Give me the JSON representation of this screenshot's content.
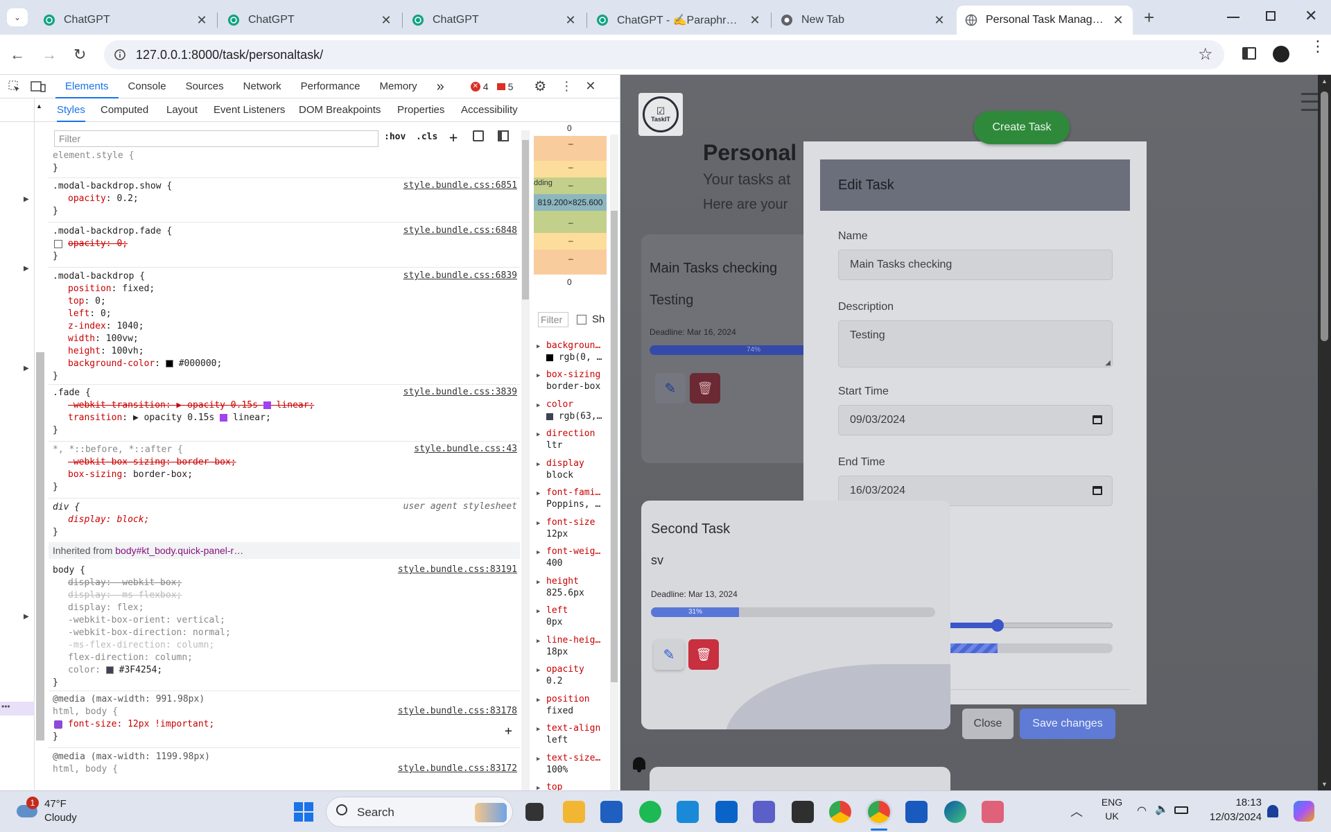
{
  "browser": {
    "tabs": [
      {
        "title": "ChatGPT"
      },
      {
        "title": "ChatGPT"
      },
      {
        "title": "ChatGPT"
      },
      {
        "title": "ChatGPT - ✍️Paraphrase &"
      },
      {
        "title": "New Tab"
      },
      {
        "title": "Personal Task Managemen"
      }
    ],
    "url": "127.0.0.1:8000/task/personaltask/"
  },
  "devtools": {
    "tabs": [
      "Elements",
      "Console",
      "Sources",
      "Network",
      "Performance",
      "Memory"
    ],
    "more": "»",
    "errors": "4",
    "warnings": "5",
    "subtabs": [
      "Styles",
      "Computed",
      "Layout",
      "Event Listeners",
      "DOM Breakpoints",
      "Properties",
      "Accessibility"
    ],
    "filter_placeholder": "Filter",
    "hov": ":hov",
    "cls": ".cls",
    "rules": {
      "element_style": "element.style {",
      "close": "}",
      "r1_sel": ".modal-backdrop.show {",
      "r1_src": "style.bundle.css:6851",
      "r1_p1": "opacity",
      "r1_v1": "0.2;",
      "r2_sel": ".modal-backdrop.fade {",
      "r2_src": "style.bundle.css:6848",
      "r2_p1": "opacity: 0;",
      "r3_sel": ".modal-backdrop {",
      "r3_src": "style.bundle.css:6839",
      "r3_props": [
        {
          "k": "position",
          "v": "fixed;"
        },
        {
          "k": "top",
          "v": "0;"
        },
        {
          "k": "left",
          "v": "0;"
        },
        {
          "k": "z-index",
          "v": "1040;"
        },
        {
          "k": "width",
          "v": "100vw;"
        },
        {
          "k": "height",
          "v": "100vh;"
        },
        {
          "k": "background-color",
          "v": "#000000;"
        }
      ],
      "r4_sel": ".fade {",
      "r4_src": "style.bundle.css:3839",
      "r4_p1": "-webkit-transition: ▶ opacity 0.15s",
      "r4_p1b": "linear;",
      "r4_p2k": "transition",
      "r4_p2v": "▶ opacity 0.15s",
      "r4_p2b": "linear;",
      "r5_sel": "*, *::before, *::after {",
      "r5_src": "style.bundle.css:43",
      "r5_p1": "-webkit-box-sizing: border-box;",
      "r5_p2k": "box-sizing",
      "r5_p2v": "border-box;",
      "r6_sel": "div {",
      "r6_src": "user agent stylesheet",
      "r6_p": "display: block;",
      "inherited_label": "Inherited from",
      "inherited_sel": "body#kt_body.quick-panel-r…",
      "r7_sel": "body {",
      "r7_src": "style.bundle.css:83191",
      "r7_lines": [
        "display: -webkit-box;",
        "display: -ms-flexbox;",
        "display: flex;",
        "-webkit-box-orient: vertical;",
        "-webkit-box-direction: normal;",
        "-ms-flex-direction: column;",
        "flex-direction: column;",
        "color: "
      ],
      "r7_color": "#3F4254;",
      "m1": "@media (max-width: 991.98px)",
      "m1_sel": "html, body {",
      "m1_src": "style.bundle.css:83178",
      "m1_p": "font-size: 12px !important;",
      "m2": "@media (max-width: 1199.98px)",
      "m2_sel": "html, body {",
      "m2_src": "style.bundle.css:83172"
    },
    "boxmodel": {
      "top": "0",
      "bottom": "0",
      "dash": "–",
      "padding_label": "dding",
      "content": "819.200×825.600"
    },
    "computed_filter": "Filter",
    "computed_show": "Sh",
    "computed": [
      {
        "k": "backgroun…",
        "v": "rgb(0, …"
      },
      {
        "k": "box-sizing",
        "v": "border-box"
      },
      {
        "k": "color",
        "v": "rgb(63,…"
      },
      {
        "k": "direction",
        "v": "ltr"
      },
      {
        "k": "display",
        "v": "block"
      },
      {
        "k": "font-fami…",
        "v": "Poppins, …"
      },
      {
        "k": "font-size",
        "v": "12px"
      },
      {
        "k": "font-weig…",
        "v": "400"
      },
      {
        "k": "height",
        "v": "825.6px"
      },
      {
        "k": "left",
        "v": "0px"
      },
      {
        "k": "line-heig…",
        "v": "18px"
      },
      {
        "k": "opacity",
        "v": "0.2"
      },
      {
        "k": "position",
        "v": "fixed"
      },
      {
        "k": "text-align",
        "v": "left"
      },
      {
        "k": "text-size…",
        "v": "100%"
      },
      {
        "k": "top",
        "v": ""
      }
    ]
  },
  "app": {
    "logo_text": "TaskIT",
    "create_task": "Create Task",
    "heading": "Personal",
    "subheading": "Your tasks at",
    "subheading2": "Here are your",
    "task1": {
      "title": "Main Tasks checking",
      "desc": "Testing",
      "deadline": "Deadline: Mar 16, 2024",
      "progress": 74,
      "progress_label": "74%"
    },
    "task2": {
      "title": "Second Task",
      "desc": "sv",
      "deadline": "Deadline: Mar 13, 2024",
      "progress": 31,
      "progress_label": "31%"
    },
    "modal": {
      "title": "Edit Task",
      "name_label": "Name",
      "name_value": "Main Tasks checking",
      "desc_label": "Description",
      "desc_value": "Testing",
      "start_label": "Start Time",
      "start_value": "09/03/2024",
      "end_label": "End Time",
      "end_value": "16/03/2024",
      "slider_value": 0.58,
      "close": "Close",
      "save": "Save changes"
    }
  },
  "taskbar": {
    "badge": "1",
    "temp": "47°F",
    "weather": "Cloudy",
    "search": "Search",
    "lang1": "ENG",
    "lang2": "UK",
    "time": "18:13",
    "date": "12/03/2024"
  }
}
